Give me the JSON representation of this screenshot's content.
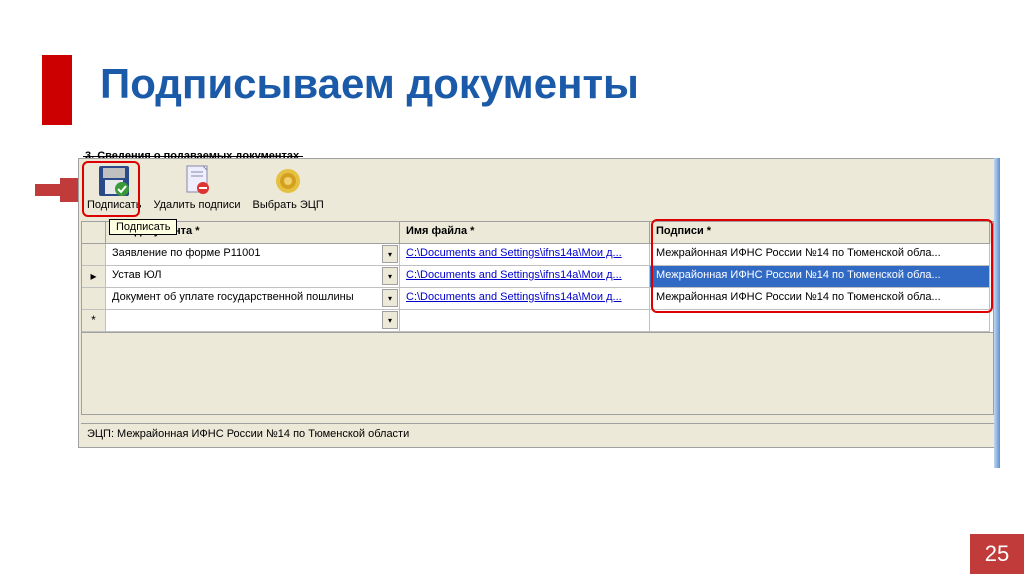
{
  "title": "Подписываем документы",
  "section_label": "3. Сведения о подаваемых документах",
  "toolbar": {
    "sign": "Подписать",
    "del": "Удалить подписи",
    "choose": "Выбрать ЭЦП"
  },
  "tooltip": "Подписать",
  "headers": {
    "doc": "ние документа *",
    "file": "Имя файла *",
    "sign": "Подписи *"
  },
  "rows": [
    {
      "marker": "",
      "doc": "Заявление по форме Р11001",
      "file": "C:\\Documents and Settings\\ifns14a\\Мои д...",
      "sign": "Межрайонная ИФНС России №14 по Тюменской обла...",
      "selected": false
    },
    {
      "marker": "▸",
      "doc": "Устав ЮЛ",
      "file": "C:\\Documents and Settings\\ifns14a\\Мои д...",
      "sign": "Межрайонная ИФНС России №14 по Тюменской обла...",
      "selected": true
    },
    {
      "marker": "",
      "doc": "Документ об уплате государственной пошлины",
      "file": "C:\\Documents and Settings\\ifns14a\\Мои д...",
      "sign": "Межрайонная ИФНС России №14 по Тюменской обла...",
      "selected": false
    },
    {
      "marker": "*",
      "doc": "",
      "file": "",
      "sign": "",
      "selected": false
    }
  ],
  "status": "ЭЦП: Межрайонная ИФНС России №14 по Тюменской области",
  "page": "25"
}
